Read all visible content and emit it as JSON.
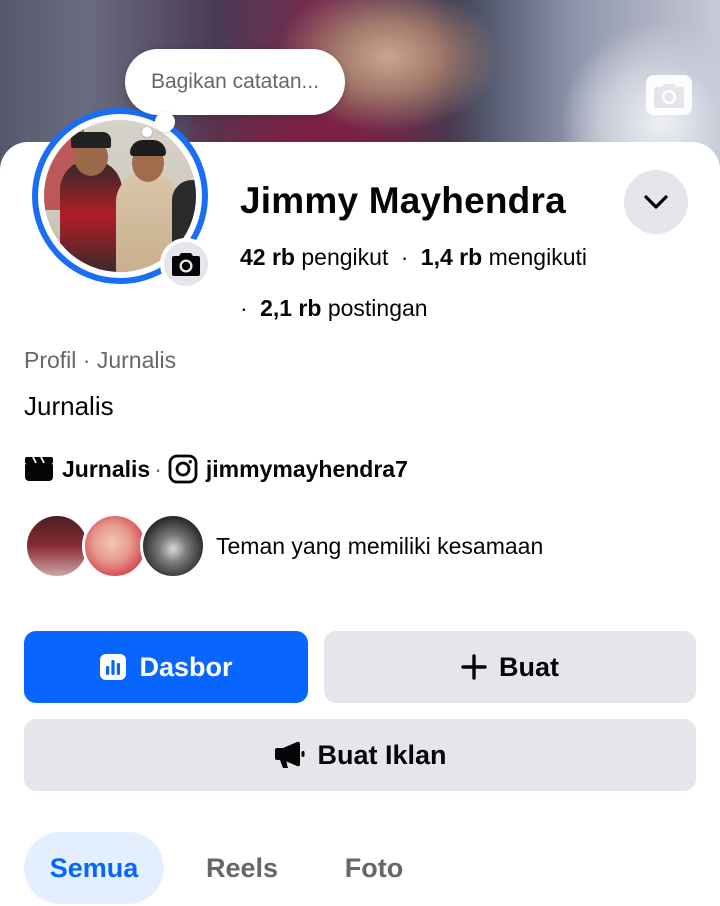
{
  "cover": {
    "camera_icon": "camera-icon"
  },
  "note": {
    "placeholder": "Bagikan catatan..."
  },
  "profile": {
    "name": "Jimmy Mayhendra",
    "followers_count": "42 rb",
    "followers_label": "pengikut",
    "following_count": "1,4 rb",
    "following_label": "mengikuti",
    "posts_count": "2,1 rb",
    "posts_label": "postingan",
    "separator": "·",
    "category_line": "Profil · Jurnalis",
    "bio": "Jurnalis",
    "link_label": "Jurnalis",
    "link_separator": "·",
    "instagram_handle": "jimmymayhendra7"
  },
  "friends": {
    "text": "Teman yang memiliki kesamaan"
  },
  "actions": {
    "dashboard_label": "Dasbor",
    "create_label": "Buat",
    "ad_label": "Buat Iklan"
  },
  "tabs": [
    {
      "label": "Semua",
      "active": true
    },
    {
      "label": "Reels",
      "active": false
    },
    {
      "label": "Foto",
      "active": false
    }
  ],
  "colors": {
    "accent": "#0866ff",
    "avatar_ring": "#1a6ef5",
    "button_gray": "#e4e6eb",
    "tab_active_bg": "#e3efff",
    "secondary_text": "#65676b"
  }
}
